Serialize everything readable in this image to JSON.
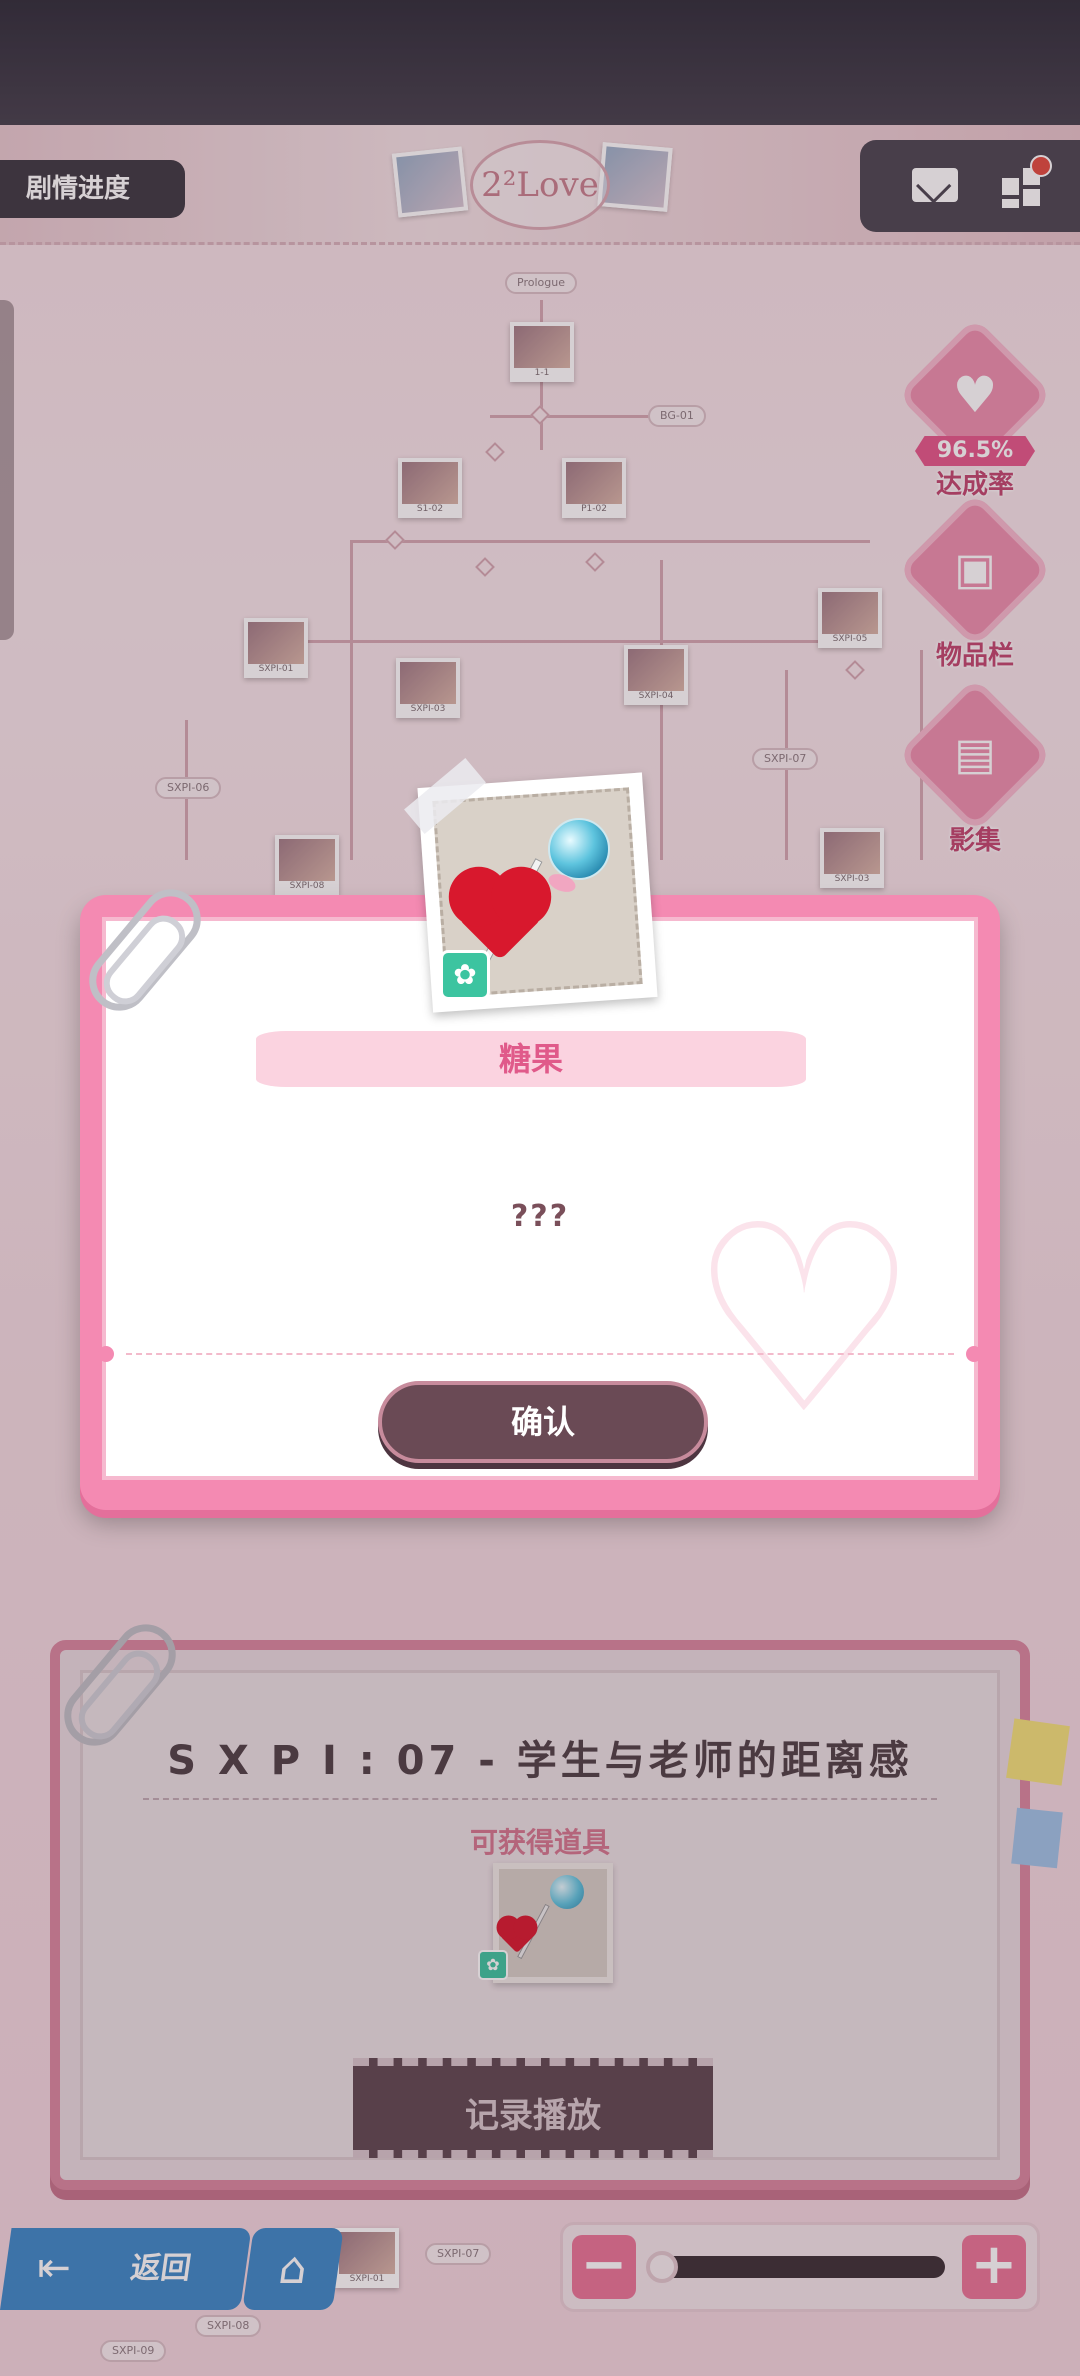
{
  "header": {
    "story_progress_label": "剧情进度",
    "banner_logo": "2²Love"
  },
  "map": {
    "start_tag": "Prologue",
    "tags": [
      "1-1",
      "BG-01",
      "S1-02",
      "P1-02",
      "SXPI-01",
      "SXPI-03",
      "SXPI-04",
      "SXPI-05",
      "SXPI-06",
      "SXPI-07",
      "SXPI-08"
    ],
    "bottom_tags": [
      "SXPI-01",
      "SXPI-07",
      "SXPI-08",
      "SXPI-09"
    ]
  },
  "side_menu": {
    "completion_rate": "96.5%",
    "completion_label": "达成率",
    "inventory_label": "物品栏",
    "gallery_label": "影集"
  },
  "story_card": {
    "title": "S X P I : 07 - 学生与老师的距离感",
    "obtainable_label": "可获得道具",
    "replay_button": "记录播放"
  },
  "bottom_controls": {
    "back_label": "返回",
    "zoom_minus": "−",
    "zoom_plus": "+",
    "zoom_level": 0
  },
  "modal": {
    "item_name": "糖果",
    "item_description": "???",
    "confirm_button": "确认"
  },
  "colors": {
    "accent_pink": "#f48ab2",
    "confirm_button": "#6a4a55",
    "item_name": "#e05a8a",
    "button_blue": "#3c88c8"
  }
}
